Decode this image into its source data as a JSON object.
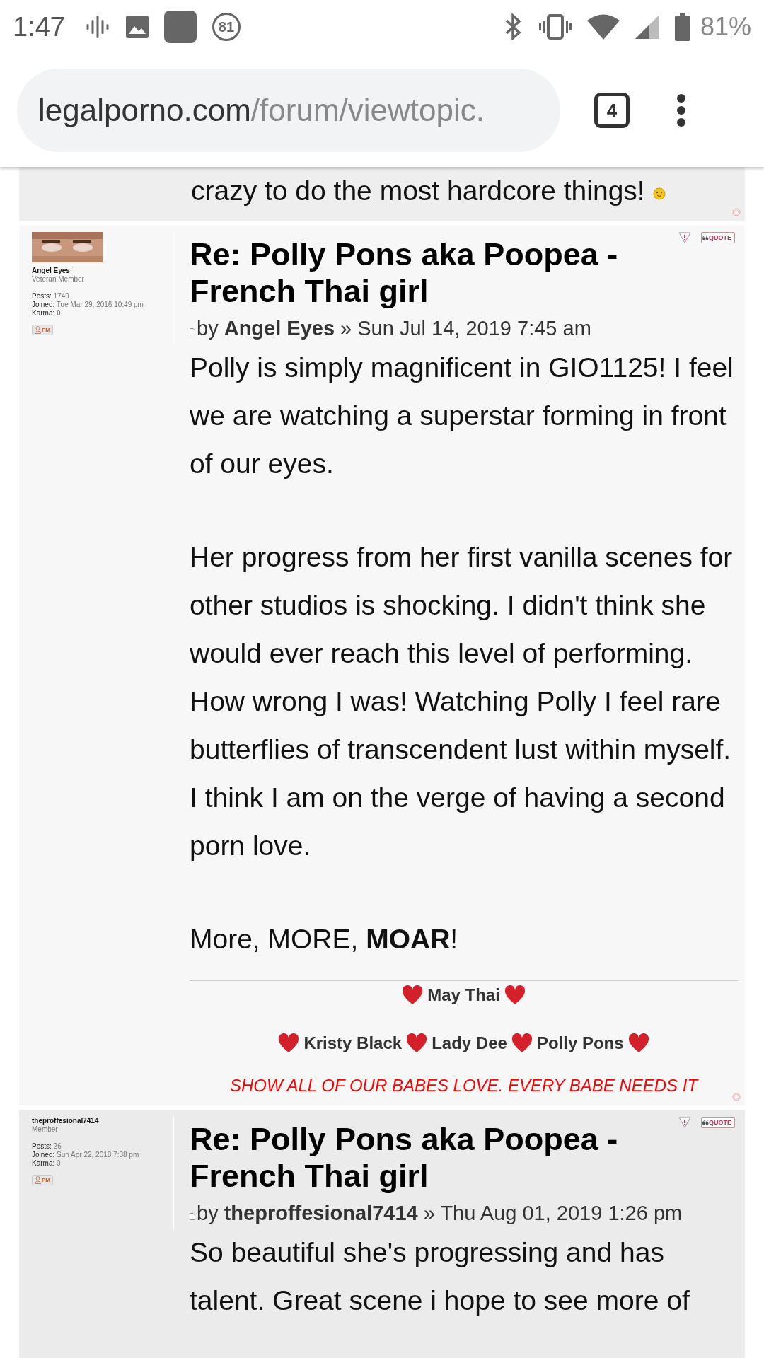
{
  "status_bar": {
    "time": "1:47",
    "notification_count": "81",
    "battery": "81%"
  },
  "browser": {
    "url_domain": "legalporno.com",
    "url_path": "/forum/viewtopic.",
    "tab_count": "4"
  },
  "posts": [
    {
      "kind": "tail",
      "body": [
        "crazy to do the most hardcore things!"
      ]
    },
    {
      "kind": "full",
      "author": "Angel Eyes",
      "rank": "Veteran Member",
      "avatar": true,
      "stats": [
        {
          "label": "Posts:",
          "value": "1749"
        },
        {
          "label": "Joined:",
          "value": "Tue Mar 29, 2016 10:49 pm"
        },
        {
          "label": "Karma:",
          "value": "**0**"
        }
      ],
      "pm": "PM",
      "quote": "QUOTE",
      "title": "Re: Polly Pons aka Poopea - French Thai girl",
      "byline": "by **Angel Eyes** » Sun Jul 14, 2019 7:45 am",
      "body": [
        {
          "before": "Polly is simply magnificent in ",
          "link": "GIO1125",
          "after": "! I feel we are watching a superstar forming in front of our eyes."
        },
        {
          "before": "Her progress from her first vanilla scenes for other studios is shocking. I didn't think she would ever reach this level of performing. How wrong I was! Watching Polly I feel rare butterflies of transcendent lust within myself. I think I am on the verge of having a second porn love."
        },
        {
          "before": "More, MORE, **MOAR**!"
        }
      ],
      "signature": {
        "lines": [
          [
            "May Thai"
          ],
          [
            "Kristy Black",
            "Lady Dee",
            "Polly Pons"
          ]
        ],
        "slogan": "SHOW ALL OF OUR BABES LOVE. EVERY BABE NEEDS IT"
      }
    },
    {
      "kind": "full",
      "author": "theproffesional7414",
      "rank": "Member",
      "avatar": false,
      "stats": [
        {
          "label": "Posts:",
          "value": "26"
        },
        {
          "label": "Joined:",
          "value": "Sun Apr 22, 2018 7:38 pm"
        },
        {
          "label": "Karma:",
          "value": "0"
        }
      ],
      "pm": "PM",
      "quote": "QUOTE",
      "title": "Re: Polly Pons aka Poopea - French Thai girl",
      "byline": "by **theproffesional7414** » Thu Aug 01, 2019 1:26 pm",
      "body": [
        {
          "before": "So beautiful she's progressing and has talent. Great scene i hope to see more of"
        }
      ]
    }
  ]
}
